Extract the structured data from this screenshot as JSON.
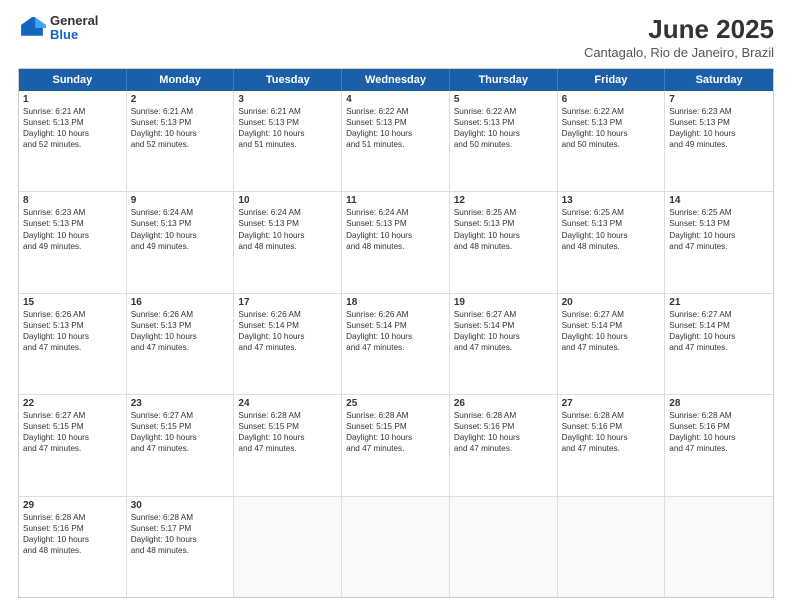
{
  "header": {
    "logo": {
      "general": "General",
      "blue": "Blue"
    },
    "title": "June 2025",
    "subtitle": "Cantagalo, Rio de Janeiro, Brazil"
  },
  "weekdays": [
    "Sunday",
    "Monday",
    "Tuesday",
    "Wednesday",
    "Thursday",
    "Friday",
    "Saturday"
  ],
  "rows": [
    [
      {
        "day": "1",
        "lines": [
          "Sunrise: 6:21 AM",
          "Sunset: 5:13 PM",
          "Daylight: 10 hours",
          "and 52 minutes."
        ]
      },
      {
        "day": "2",
        "lines": [
          "Sunrise: 6:21 AM",
          "Sunset: 5:13 PM",
          "Daylight: 10 hours",
          "and 52 minutes."
        ]
      },
      {
        "day": "3",
        "lines": [
          "Sunrise: 6:21 AM",
          "Sunset: 5:13 PM",
          "Daylight: 10 hours",
          "and 51 minutes."
        ]
      },
      {
        "day": "4",
        "lines": [
          "Sunrise: 6:22 AM",
          "Sunset: 5:13 PM",
          "Daylight: 10 hours",
          "and 51 minutes."
        ]
      },
      {
        "day": "5",
        "lines": [
          "Sunrise: 6:22 AM",
          "Sunset: 5:13 PM",
          "Daylight: 10 hours",
          "and 50 minutes."
        ]
      },
      {
        "day": "6",
        "lines": [
          "Sunrise: 6:22 AM",
          "Sunset: 5:13 PM",
          "Daylight: 10 hours",
          "and 50 minutes."
        ]
      },
      {
        "day": "7",
        "lines": [
          "Sunrise: 6:23 AM",
          "Sunset: 5:13 PM",
          "Daylight: 10 hours",
          "and 49 minutes."
        ]
      }
    ],
    [
      {
        "day": "8",
        "lines": [
          "Sunrise: 6:23 AM",
          "Sunset: 5:13 PM",
          "Daylight: 10 hours",
          "and 49 minutes."
        ]
      },
      {
        "day": "9",
        "lines": [
          "Sunrise: 6:24 AM",
          "Sunset: 5:13 PM",
          "Daylight: 10 hours",
          "and 49 minutes."
        ]
      },
      {
        "day": "10",
        "lines": [
          "Sunrise: 6:24 AM",
          "Sunset: 5:13 PM",
          "Daylight: 10 hours",
          "and 48 minutes."
        ]
      },
      {
        "day": "11",
        "lines": [
          "Sunrise: 6:24 AM",
          "Sunset: 5:13 PM",
          "Daylight: 10 hours",
          "and 48 minutes."
        ]
      },
      {
        "day": "12",
        "lines": [
          "Sunrise: 6:25 AM",
          "Sunset: 5:13 PM",
          "Daylight: 10 hours",
          "and 48 minutes."
        ]
      },
      {
        "day": "13",
        "lines": [
          "Sunrise: 6:25 AM",
          "Sunset: 5:13 PM",
          "Daylight: 10 hours",
          "and 48 minutes."
        ]
      },
      {
        "day": "14",
        "lines": [
          "Sunrise: 6:25 AM",
          "Sunset: 5:13 PM",
          "Daylight: 10 hours",
          "and 47 minutes."
        ]
      }
    ],
    [
      {
        "day": "15",
        "lines": [
          "Sunrise: 6:26 AM",
          "Sunset: 5:13 PM",
          "Daylight: 10 hours",
          "and 47 minutes."
        ]
      },
      {
        "day": "16",
        "lines": [
          "Sunrise: 6:26 AM",
          "Sunset: 5:13 PM",
          "Daylight: 10 hours",
          "and 47 minutes."
        ]
      },
      {
        "day": "17",
        "lines": [
          "Sunrise: 6:26 AM",
          "Sunset: 5:14 PM",
          "Daylight: 10 hours",
          "and 47 minutes."
        ]
      },
      {
        "day": "18",
        "lines": [
          "Sunrise: 6:26 AM",
          "Sunset: 5:14 PM",
          "Daylight: 10 hours",
          "and 47 minutes."
        ]
      },
      {
        "day": "19",
        "lines": [
          "Sunrise: 6:27 AM",
          "Sunset: 5:14 PM",
          "Daylight: 10 hours",
          "and 47 minutes."
        ]
      },
      {
        "day": "20",
        "lines": [
          "Sunrise: 6:27 AM",
          "Sunset: 5:14 PM",
          "Daylight: 10 hours",
          "and 47 minutes."
        ]
      },
      {
        "day": "21",
        "lines": [
          "Sunrise: 6:27 AM",
          "Sunset: 5:14 PM",
          "Daylight: 10 hours",
          "and 47 minutes."
        ]
      }
    ],
    [
      {
        "day": "22",
        "lines": [
          "Sunrise: 6:27 AM",
          "Sunset: 5:15 PM",
          "Daylight: 10 hours",
          "and 47 minutes."
        ]
      },
      {
        "day": "23",
        "lines": [
          "Sunrise: 6:27 AM",
          "Sunset: 5:15 PM",
          "Daylight: 10 hours",
          "and 47 minutes."
        ]
      },
      {
        "day": "24",
        "lines": [
          "Sunrise: 6:28 AM",
          "Sunset: 5:15 PM",
          "Daylight: 10 hours",
          "and 47 minutes."
        ]
      },
      {
        "day": "25",
        "lines": [
          "Sunrise: 6:28 AM",
          "Sunset: 5:15 PM",
          "Daylight: 10 hours",
          "and 47 minutes."
        ]
      },
      {
        "day": "26",
        "lines": [
          "Sunrise: 6:28 AM",
          "Sunset: 5:16 PM",
          "Daylight: 10 hours",
          "and 47 minutes."
        ]
      },
      {
        "day": "27",
        "lines": [
          "Sunrise: 6:28 AM",
          "Sunset: 5:16 PM",
          "Daylight: 10 hours",
          "and 47 minutes."
        ]
      },
      {
        "day": "28",
        "lines": [
          "Sunrise: 6:28 AM",
          "Sunset: 5:16 PM",
          "Daylight: 10 hours",
          "and 47 minutes."
        ]
      }
    ],
    [
      {
        "day": "29",
        "lines": [
          "Sunrise: 6:28 AM",
          "Sunset: 5:16 PM",
          "Daylight: 10 hours",
          "and 48 minutes."
        ]
      },
      {
        "day": "30",
        "lines": [
          "Sunrise: 6:28 AM",
          "Sunset: 5:17 PM",
          "Daylight: 10 hours",
          "and 48 minutes."
        ]
      },
      {
        "day": "",
        "lines": []
      },
      {
        "day": "",
        "lines": []
      },
      {
        "day": "",
        "lines": []
      },
      {
        "day": "",
        "lines": []
      },
      {
        "day": "",
        "lines": []
      }
    ]
  ]
}
